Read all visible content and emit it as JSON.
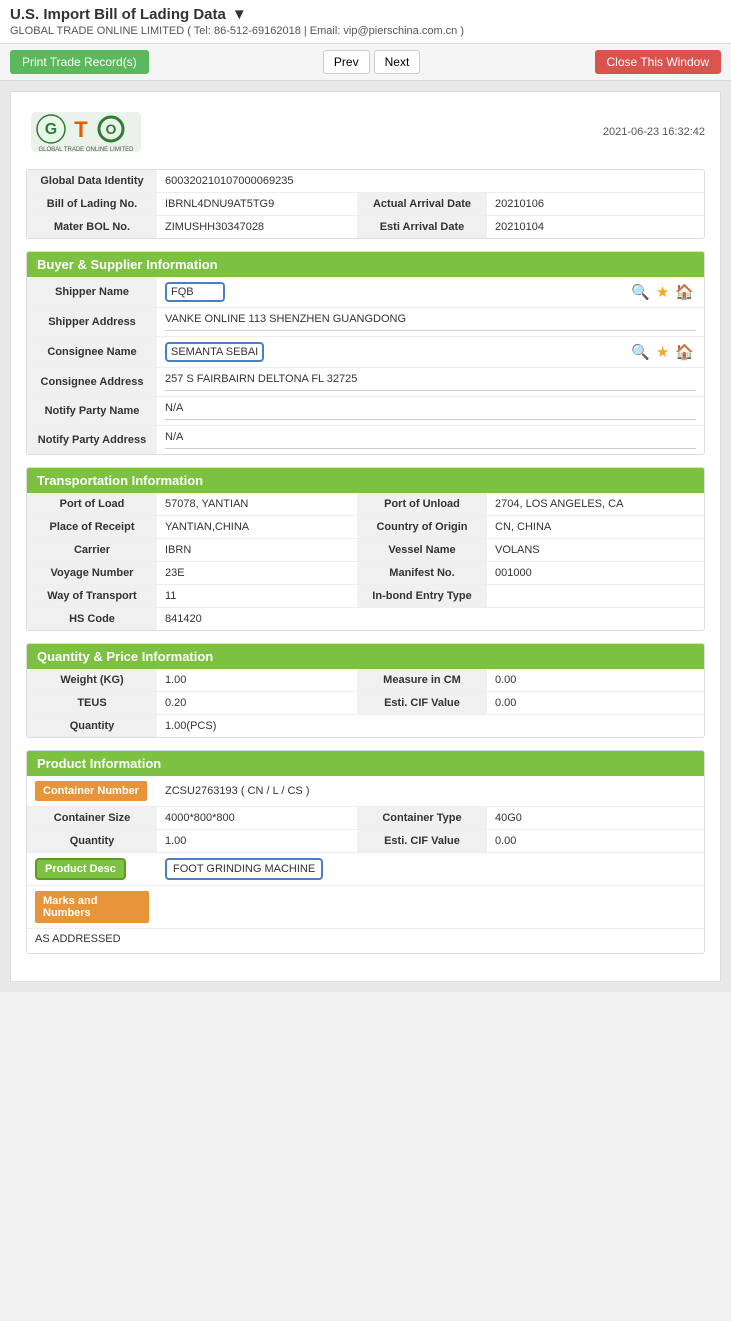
{
  "app": {
    "title": "U.S. Import Bill of Lading Data",
    "company_info": "GLOBAL TRADE ONLINE LIMITED ( Tel: 86-512-69162018 | Email: vip@pierschina.com.cn )",
    "arrow": "▼"
  },
  "toolbar": {
    "print_label": "Print Trade Record(s)",
    "prev_label": "Prev",
    "next_label": "Next",
    "close_label": "Close This Window"
  },
  "doc": {
    "timestamp": "2021-06-23 16:32:42",
    "logo_text": "GLOBAL TRADE ONLINE LIMITED"
  },
  "bill_section": {
    "global_data_identity_label": "Global Data Identity",
    "global_data_identity_value": "600320210107000069235",
    "bill_of_lading_no_label": "Bill of Lading No.",
    "bill_of_lading_no_value": "IBRNL4DNU9AT5TG9",
    "actual_arrival_date_label": "Actual Arrival Date",
    "actual_arrival_date_value": "20210106",
    "master_bol_no_label": "Mater BOL No.",
    "master_bol_no_value": "ZIMUSHH30347028",
    "esti_arrival_date_label": "Esti Arrival Date",
    "esti_arrival_date_value": "20210104"
  },
  "buyer_supplier": {
    "header": "Buyer & Supplier Information",
    "shipper_name_label": "Shipper Name",
    "shipper_name_value": "FQB",
    "shipper_address_label": "Shipper Address",
    "shipper_address_value": "VANKE ONLINE 113 SHENZHEN GUANGDONG",
    "consignee_name_label": "Consignee Name",
    "consignee_name_value": "SEMANTA SEBAI",
    "consignee_address_label": "Consignee Address",
    "consignee_address_value": "257 S FAIRBAIRN DELTONA FL 32725",
    "notify_party_name_label": "Notify Party Name",
    "notify_party_name_value": "N/A",
    "notify_party_address_label": "Notify Party Address",
    "notify_party_address_value": "N/A"
  },
  "transportation": {
    "header": "Transportation Information",
    "port_of_load_label": "Port of Load",
    "port_of_load_value": "57078, YANTIAN",
    "port_of_unload_label": "Port of Unload",
    "port_of_unload_value": "2704, LOS ANGELES, CA",
    "place_of_receipt_label": "Place of Receipt",
    "place_of_receipt_value": "YANTIAN,CHINA",
    "country_of_origin_label": "Country of Origin",
    "country_of_origin_value": "CN, CHINA",
    "carrier_label": "Carrier",
    "carrier_value": "IBRN",
    "vessel_name_label": "Vessel Name",
    "vessel_name_value": "VOLANS",
    "voyage_number_label": "Voyage Number",
    "voyage_number_value": "23E",
    "manifest_no_label": "Manifest No.",
    "manifest_no_value": "001000",
    "way_of_transport_label": "Way of Transport",
    "way_of_transport_value": "11",
    "in_bond_entry_type_label": "In-bond Entry Type",
    "in_bond_entry_type_value": "",
    "hs_code_label": "HS Code",
    "hs_code_value": "841420"
  },
  "quantity_price": {
    "header": "Quantity & Price Information",
    "weight_kg_label": "Weight (KG)",
    "weight_kg_value": "1.00",
    "measure_in_cm_label": "Measure in CM",
    "measure_in_cm_value": "0.00",
    "teus_label": "TEUS",
    "teus_value": "0.20",
    "esti_cif_value_label": "Esti. CIF Value",
    "esti_cif_value_value": "0.00",
    "quantity_label": "Quantity",
    "quantity_value": "1.00(PCS)"
  },
  "product_info": {
    "header": "Product Information",
    "container_number_label": "Container Number",
    "container_number_value": "ZCSU2763193 ( CN / L / CS )",
    "container_size_label": "Container Size",
    "container_size_value": "4000*800*800",
    "container_type_label": "Container Type",
    "container_type_value": "40G0",
    "quantity_label": "Quantity",
    "quantity_value": "1.00",
    "esti_cif_value_label": "Esti. CIF Value",
    "esti_cif_value_value": "0.00",
    "product_desc_label": "Product Desc",
    "product_desc_value": "FOOT GRINDING MACHINE",
    "marks_and_numbers_label": "Marks and Numbers",
    "marks_and_numbers_value": "AS ADDRESSED"
  },
  "icons": {
    "search": "🔍",
    "star": "★",
    "home": "🏠",
    "dropdown": "▼"
  }
}
